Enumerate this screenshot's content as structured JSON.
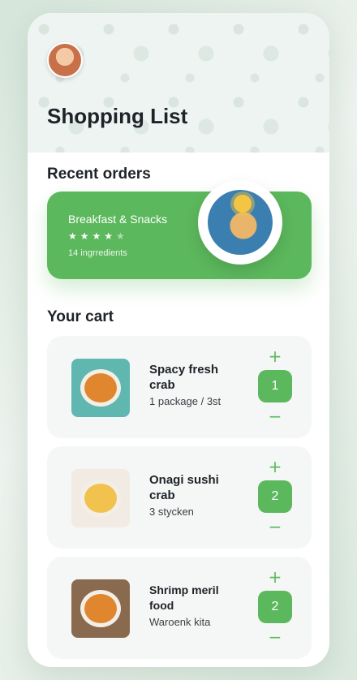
{
  "page": {
    "title": "Shopping List"
  },
  "recent": {
    "heading": "Recent orders",
    "card": {
      "title": "Breakfast & Snacks",
      "stars_filled": "★★★★",
      "stars_empty": "★",
      "ingredients": "14 ingrredients",
      "rating": 4
    }
  },
  "cart": {
    "heading": "Your cart",
    "items": [
      {
        "name": "Spacy fresh crab",
        "sub": "1 package / 3st",
        "qty": "1"
      },
      {
        "name": "Onagi sushi crab",
        "sub": "3 stycken",
        "qty": "2"
      },
      {
        "name": "Shrimp meril food",
        "sub": "Waroenk kita",
        "qty": "2"
      }
    ],
    "plus": "+",
    "minus": "−"
  },
  "colors": {
    "accent": "#5cb85c",
    "text": "#1f2328",
    "card": "#f5f7f6"
  },
  "icons": {
    "avatar": "avatar",
    "plus": "plus-icon",
    "minus": "minus-icon"
  }
}
